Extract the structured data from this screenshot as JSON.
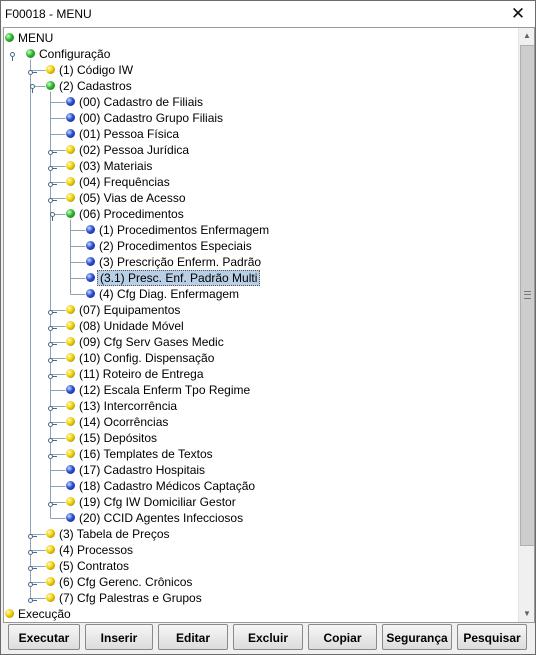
{
  "window": {
    "title": "F00018 - MENU",
    "close_label": "✕"
  },
  "tree": {
    "nodes": [
      {
        "label": "MENU",
        "color": "green"
      },
      {
        "label": "Configuração",
        "color": "green"
      },
      {
        "label": "(1) Código IW",
        "color": "yellow"
      },
      {
        "label": "(2) Cadastros",
        "color": "green"
      },
      {
        "label": "(00) Cadastro de Filiais",
        "color": "blue"
      },
      {
        "label": "(00) Cadastro Grupo Filiais",
        "color": "blue"
      },
      {
        "label": "(01) Pessoa Física",
        "color": "blue"
      },
      {
        "label": "(02) Pessoa Jurídica",
        "color": "yellow"
      },
      {
        "label": "(03) Materiais",
        "color": "yellow"
      },
      {
        "label": "(04) Frequências",
        "color": "yellow"
      },
      {
        "label": "(05) Vias de Acesso",
        "color": "yellow"
      },
      {
        "label": "(06) Procedimentos",
        "color": "green"
      },
      {
        "label": "(1) Procedimentos Enfermagem",
        "color": "blue"
      },
      {
        "label": "(2) Procedimentos Especiais",
        "color": "blue"
      },
      {
        "label": "(3) Prescrição Enferm. Padrão",
        "color": "blue"
      },
      {
        "label": "(3.1) Presc. Enf. Padrão Multi",
        "color": "blue",
        "selected": true
      },
      {
        "label": "(4) Cfg Diag. Enfermagem",
        "color": "blue"
      },
      {
        "label": "(07) Equipamentos",
        "color": "yellow"
      },
      {
        "label": "(08) Unidade Móvel",
        "color": "yellow"
      },
      {
        "label": "(09) Cfg Serv Gases Medic",
        "color": "yellow"
      },
      {
        "label": "(10) Config. Dispensação",
        "color": "yellow"
      },
      {
        "label": "(11) Roteiro de Entrega",
        "color": "yellow"
      },
      {
        "label": "(12) Escala Enferm Tpo Regime",
        "color": "blue"
      },
      {
        "label": "(13) Intercorrência",
        "color": "yellow"
      },
      {
        "label": "(14) Ocorrências",
        "color": "yellow"
      },
      {
        "label": "(15) Depósitos",
        "color": "yellow"
      },
      {
        "label": "(16) Templates de Textos",
        "color": "yellow"
      },
      {
        "label": "(17) Cadastro Hospitais",
        "color": "blue"
      },
      {
        "label": "(18) Cadastro Médicos Captação",
        "color": "blue"
      },
      {
        "label": "(19) Cfg IW Domiciliar Gestor",
        "color": "yellow"
      },
      {
        "label": "(20) CCID Agentes Infecciosos",
        "color": "blue"
      },
      {
        "label": "(3) Tabela de Preços",
        "color": "yellow"
      },
      {
        "label": "(4) Processos",
        "color": "yellow"
      },
      {
        "label": "(5) Contratos",
        "color": "yellow"
      },
      {
        "label": "(6) Cfg Gerenc. Crônicos",
        "color": "yellow"
      },
      {
        "label": "(7) Cfg Palestras e Grupos",
        "color": "yellow"
      },
      {
        "label": "Execução",
        "color": "yellow"
      }
    ]
  },
  "buttons": [
    {
      "label": "Executar"
    },
    {
      "label": "Inserir"
    },
    {
      "label": "Editar"
    },
    {
      "label": "Excluir"
    },
    {
      "label": "Copiar"
    },
    {
      "label": "Segurança"
    },
    {
      "label": "Pesquisar"
    }
  ],
  "scrollbar": {
    "up_icon": "▲",
    "down_icon": "▼"
  }
}
